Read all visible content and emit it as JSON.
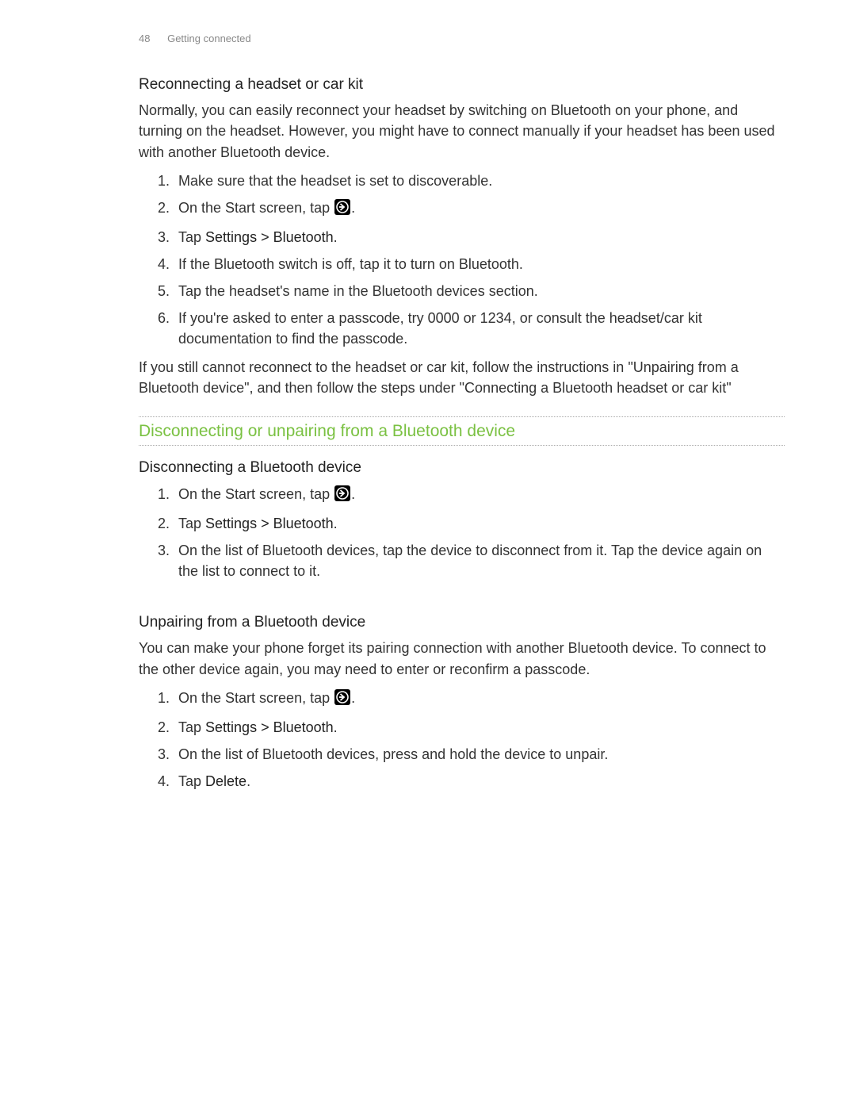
{
  "header": {
    "page_number": "48",
    "section": "Getting connected"
  },
  "reconnecting": {
    "title": "Reconnecting a headset or car kit",
    "intro": "Normally, you can easily reconnect your headset by switching on Bluetooth on your phone, and turning on the headset. However, you might have to connect manually if your headset has been used with another Bluetooth device.",
    "steps": {
      "s1": "Make sure that the headset is set to discoverable.",
      "s2a": "On the Start screen, tap ",
      "s2b": ".",
      "s3a": "Tap ",
      "s3b": "Settings > Bluetooth",
      "s3c": ".",
      "s4": "If the Bluetooth switch is off, tap it to turn on Bluetooth.",
      "s5": "Tap the headset's name in the Bluetooth devices section.",
      "s6": "If you're asked to enter a passcode, try 0000 or 1234, or consult the headset/car kit documentation to find the passcode."
    },
    "outro": "If you still cannot reconnect to the headset or car kit, follow the instructions in \"Unpairing from a Bluetooth device\", and then follow the steps under \"Connecting a Bluetooth headset or car kit\""
  },
  "section_heading": "Disconnecting or unpairing from a Bluetooth device",
  "disconnecting": {
    "title": "Disconnecting a Bluetooth device",
    "steps": {
      "s1a": "On the Start screen, tap ",
      "s1b": ".",
      "s2a": "Tap ",
      "s2b": "Settings > Bluetooth",
      "s2c": ".",
      "s3": "On the list of Bluetooth devices, tap the device to disconnect from it. Tap the device again on the list to connect to it."
    }
  },
  "unpairing": {
    "title": "Unpairing from a Bluetooth device",
    "intro": "You can make your phone forget its pairing connection with another Bluetooth device. To connect to the other device again, you may need to enter or reconfirm a passcode.",
    "steps": {
      "s1a": "On the Start screen, tap ",
      "s1b": ".",
      "s2a": "Tap ",
      "s2b": "Settings > Bluetooth",
      "s2c": ".",
      "s3": "On the list of Bluetooth devices, press and hold the device to unpair.",
      "s4a": "Tap ",
      "s4b": "Delete",
      "s4c": "."
    }
  }
}
